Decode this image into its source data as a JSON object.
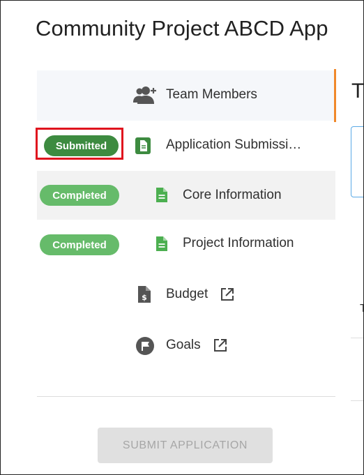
{
  "page": {
    "title": "Community Project ABCD App"
  },
  "nav": {
    "items": [
      {
        "label": "Team Members",
        "icon": "add-person-icon"
      },
      {
        "label": "Application Submissi…",
        "icon": "document-icon",
        "status": "Submitted"
      },
      {
        "label": "Core Information",
        "icon": "document-icon",
        "status": "Completed"
      },
      {
        "label": "Project Information",
        "icon": "document-icon",
        "status": "Completed"
      },
      {
        "label": "Budget",
        "icon": "budget-file-icon",
        "external": "external-link-icon"
      },
      {
        "label": "Goals",
        "icon": "flag-icon",
        "external": "external-link-icon"
      }
    ]
  },
  "actions": {
    "submit_label": "SUBMIT APPLICATION"
  },
  "right_panel": {
    "heading": "T",
    "small": "T"
  },
  "colors": {
    "submitted": "#3d8b40",
    "completed": "#66bb6a",
    "doc_icon_green": "#4caf50",
    "highlight_border": "#e0141e",
    "active_indicator": "#f0882a"
  }
}
